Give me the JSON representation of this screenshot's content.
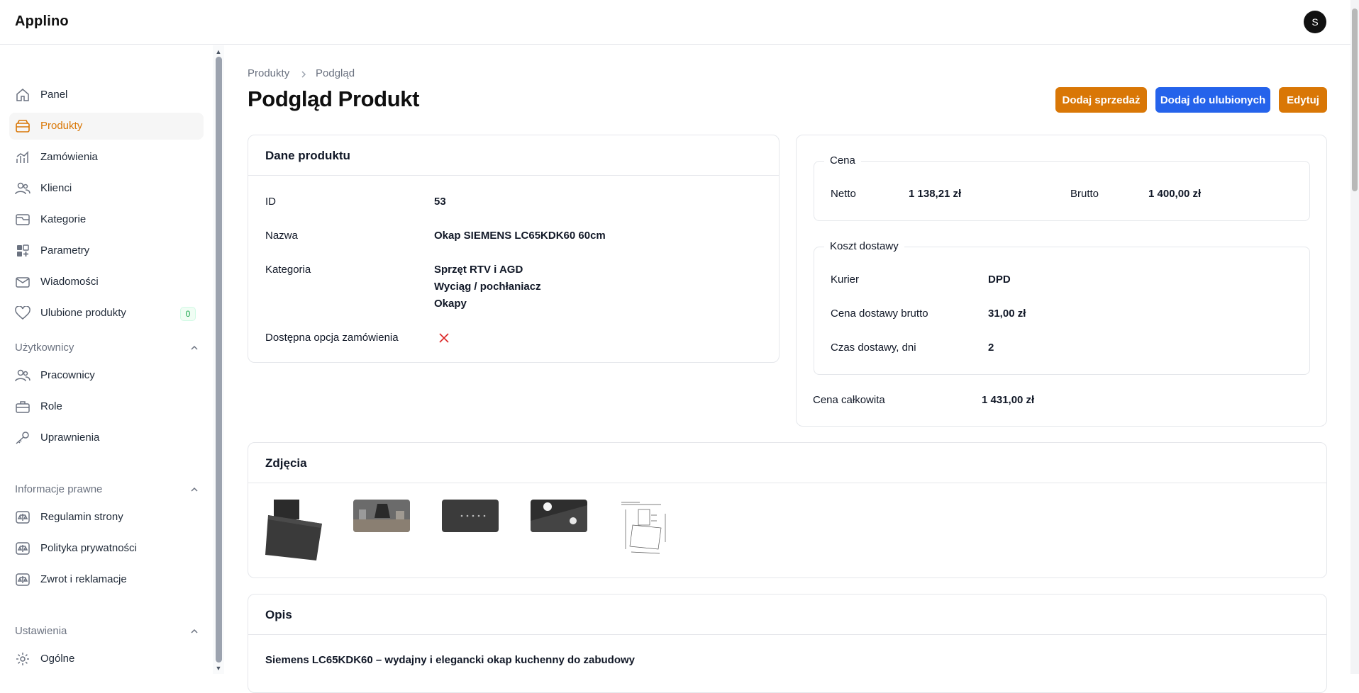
{
  "app": {
    "name": "Applino",
    "avatar_initial": "S"
  },
  "sidebar": {
    "items": [
      {
        "label": "Panel",
        "icon": "home-icon"
      },
      {
        "label": "Produkty",
        "icon": "box-icon",
        "active": true
      },
      {
        "label": "Zamówienia",
        "icon": "chart-icon"
      },
      {
        "label": "Klienci",
        "icon": "users-icon"
      },
      {
        "label": "Kategorie",
        "icon": "folder-icon"
      },
      {
        "label": "Parametry",
        "icon": "grid-icon"
      },
      {
        "label": "Wiadomości",
        "icon": "mail-icon"
      },
      {
        "label": "Ulubione produkty",
        "icon": "heart-icon",
        "badge": "0"
      }
    ],
    "sections": [
      {
        "title": "Użytkownicy",
        "items": [
          "Pracownicy",
          "Role",
          "Uprawnienia"
        ]
      },
      {
        "title": "Informacje prawne",
        "items": [
          "Regulamin strony",
          "Polityka prywatności",
          "Zwrot i reklamacje"
        ]
      },
      {
        "title": "Ustawienia",
        "items": [
          "Ogólne"
        ]
      }
    ]
  },
  "breadcrumb": {
    "items": [
      "Produkty",
      "Podgląd"
    ]
  },
  "page": {
    "title": "Podgląd Produkt"
  },
  "actions": {
    "add_sale": "Dodaj sprzedaż",
    "add_favorite": "Dodaj do ulubionych",
    "edit": "Edytuj"
  },
  "product": {
    "section_title": "Dane produktu",
    "id_label": "ID",
    "id_value": "53",
    "name_label": "Nazwa",
    "name_value": "Okap SIEMENS LC65KDK60 60cm",
    "category_label": "Kategoria",
    "categories": [
      "Sprzęt RTV i AGD",
      "Wyciąg / pochłaniacz",
      "Okapy"
    ],
    "order_option_label": "Dostępna opcja zamówienia",
    "order_option_available": false
  },
  "price": {
    "legend": "Cena",
    "netto_label": "Netto",
    "netto_value": "1 138,21 zł",
    "brutto_label": "Brutto",
    "brutto_value": "1 400,00 zł"
  },
  "delivery": {
    "legend": "Koszt dostawy",
    "courier_label": "Kurier",
    "courier_value": "DPD",
    "cost_label": "Cena dostawy brutto",
    "cost_value": "31,00 zł",
    "time_label": "Czas dostawy, dni",
    "time_value": "2"
  },
  "total": {
    "label": "Cena całkowita",
    "value": "1 431,00 zł"
  },
  "photos": {
    "section_title": "Zdjęcia",
    "count": 5
  },
  "description": {
    "section_title": "Opis",
    "heading": "Siemens LC65KDK60 – wydajny i elegancki okap kuchenny do zabudowy"
  },
  "colors": {
    "accent": "#d97706",
    "primary_blue": "#2563eb",
    "badge_green": "#16a34a",
    "error_red": "#dc2626"
  }
}
